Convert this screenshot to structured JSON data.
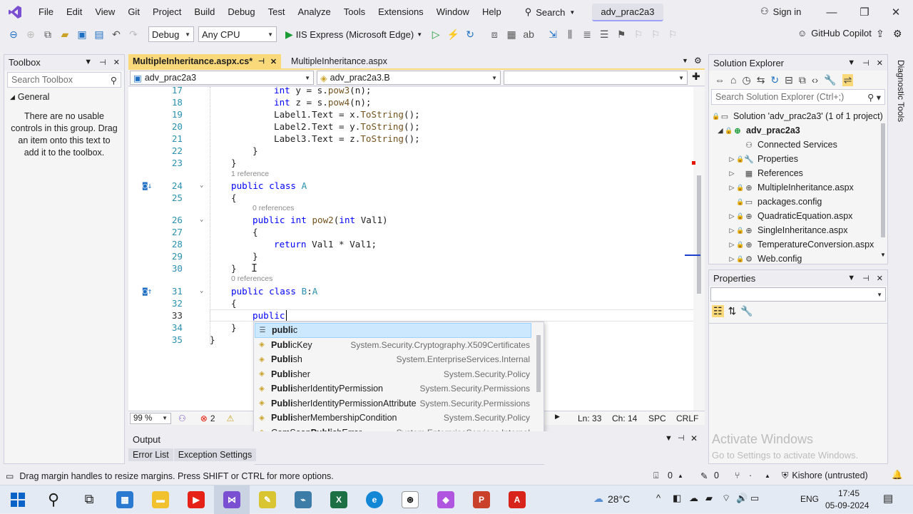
{
  "menubar": {
    "items": [
      "File",
      "Edit",
      "View",
      "Git",
      "Project",
      "Build",
      "Debug",
      "Test",
      "Analyze",
      "Tools",
      "Extensions",
      "Window",
      "Help"
    ],
    "search_label": "Search",
    "solution_title": "adv_prac2a3",
    "signin_label": "Sign in"
  },
  "toolbar": {
    "config": "Debug",
    "platform": "Any CPU",
    "run_target": "IIS Express (Microsoft Edge)",
    "copilot_label": "GitHub Copilot"
  },
  "toolbox": {
    "title": "Toolbox",
    "search_placeholder": "Search Toolbox",
    "group": "General",
    "empty_message": "There are no usable controls in this group. Drag an item onto this text to add it to the toolbox."
  },
  "editor": {
    "tabs": [
      {
        "label": "MultipleInheritance.aspx.cs*",
        "active": true
      },
      {
        "label": "MultipleInheritance.aspx",
        "active": false
      }
    ],
    "nav_project": "adv_prac2a3",
    "nav_type": "adv_prac2a3.B",
    "nav_member": "",
    "line_numbers": [
      "17",
      "18",
      "19",
      "20",
      "21",
      "22",
      "23",
      "24",
      "25",
      "26",
      "27",
      "28",
      "29",
      "30",
      "31",
      "32",
      "33",
      "34",
      "35"
    ],
    "lens": {
      "ref1": "1 reference",
      "ref0a": "0 references",
      "ref0b": "0 references"
    },
    "zoom": "99 %",
    "errors": "2",
    "position": {
      "line": "Ln: 33",
      "col": "Ch: 14",
      "spc": "SPC",
      "eol": "CRLF"
    }
  },
  "intellisense": {
    "items": [
      {
        "bold": "publi",
        "rest": "c",
        "ns": ""
      },
      {
        "bold": "Publ",
        "rest": "icKey",
        "ns": "System.Security.Cryptography.X509Certificates"
      },
      {
        "bold": "Publi",
        "rest": "sh",
        "ns": "System.EnterpriseServices.Internal"
      },
      {
        "bold": "Publi",
        "rest": "sher",
        "ns": "System.Security.Policy"
      },
      {
        "bold": "Publi",
        "rest": "sherIdentityPermission",
        "ns": "System.Security.Permissions"
      },
      {
        "bold": "Publi",
        "rest": "sherIdentityPermissionAttribute",
        "ns": "System.Security.Permissions"
      },
      {
        "bold": "Publi",
        "rest": "sherMembershipCondition",
        "ns": "System.Security.Policy"
      },
      {
        "prefix": "ComSoap",
        "bold": "Publi",
        "rest": "shError",
        "ns": "System.EnterpriseServices.Internal"
      }
    ]
  },
  "solution_explorer": {
    "title": "Solution Explorer",
    "search_placeholder": "Search Solution Explorer (Ctrl+;)",
    "solution": "Solution 'adv_prac2a3' (1 of 1 project)",
    "project": "adv_prac2a3",
    "items": [
      "Connected Services",
      "Properties",
      "References",
      "MultipleInheritance.aspx",
      "packages.config",
      "QuadraticEquation.aspx",
      "SingleInheritance.aspx",
      "TemperatureConversion.aspx",
      "Web.config"
    ]
  },
  "properties": {
    "title": "Properties"
  },
  "diagnostic_tools": "Diagnostic Tools",
  "output": {
    "title": "Output",
    "tabs": [
      "Error List",
      "Exception Settings"
    ]
  },
  "activate": {
    "title": "Activate Windows",
    "subtitle": "Go to Settings to activate Windows."
  },
  "statusbar": {
    "message": "Drag margin handles to resize margins. Press SHIFT or CTRL for more options.",
    "up_count": "0",
    "edit_count": "0",
    "user": "Kishore (untrusted)"
  },
  "taskbar": {
    "weather": "28°C",
    "lang": "ENG",
    "time": "17:45",
    "date": "05-09-2024"
  }
}
